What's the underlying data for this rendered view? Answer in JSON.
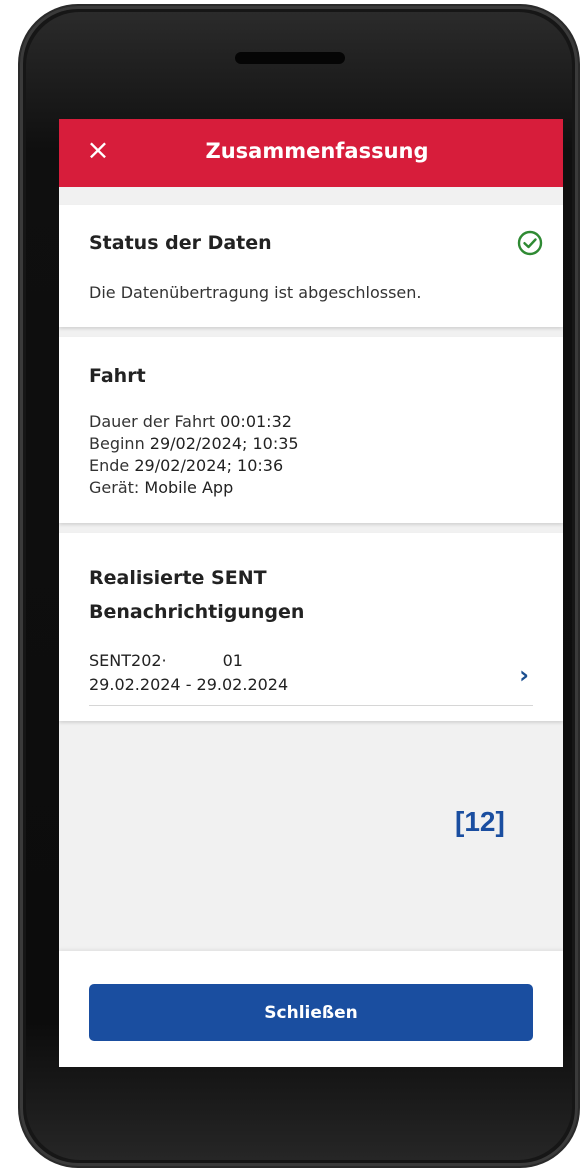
{
  "header": {
    "title": "Zusammenfassung",
    "close_icon": "×"
  },
  "status_card": {
    "title": "Status der Daten",
    "message": "Die Datenübertragung ist abgeschlossen.",
    "status_color": "#2f8a33"
  },
  "trip_card": {
    "title": "Fahrt",
    "duration_label": "Dauer der Fahrt",
    "duration_value": "00:01:32",
    "start_label": "Beginn",
    "start_value": "29/02/2024; 10:35",
    "end_label": "Ende",
    "end_value": "29/02/2024; 10:36",
    "device_label": "Gerät:",
    "device_value": "Mobile App"
  },
  "sent_card": {
    "title_line1": "Realisierte SENT",
    "title_line2": "Benachrichtigungen",
    "items": [
      {
        "id": "SENT202·           01",
        "date_range": "29.02.2024 - 29.02.2024"
      }
    ]
  },
  "footer": {
    "close_label": "Schließen"
  },
  "annotation": {
    "step_label": "[12]"
  },
  "colors": {
    "header_red": "#d71d3b",
    "primary_blue": "#1a4ea0"
  }
}
